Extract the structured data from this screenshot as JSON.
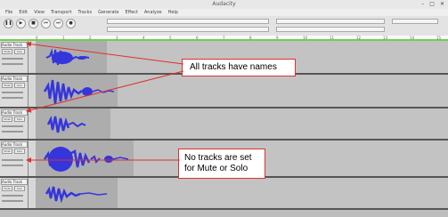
{
  "app": {
    "title": "Audacity"
  },
  "window_controls": {
    "minimize": "–",
    "maximize": "□",
    "close": "✕"
  },
  "menu": [
    "File",
    "Edit",
    "View",
    "Transport",
    "Tracks",
    "Generate",
    "Effect",
    "Analyze",
    "Help"
  ],
  "toolbar": {
    "transport_icons": [
      "pause-icon",
      "play-icon",
      "stop-icon",
      "skip-start-icon",
      "skip-end-icon",
      "record-icon"
    ],
    "transport_glyphs": [
      "❚❚",
      "▶",
      "■",
      "⏮",
      "⏭",
      "●"
    ]
  },
  "ruler": {
    "ticks": [
      "0",
      "1",
      "2",
      "3",
      "4",
      "5",
      "6",
      "7",
      "8",
      "9",
      "10",
      "11",
      "12",
      "13",
      "14",
      "15"
    ]
  },
  "tracks": [
    {
      "name": "Audio Track",
      "mute_label": "Mute",
      "solo_label": "Solo"
    },
    {
      "name": "Audio Track",
      "mute_label": "Mute",
      "solo_label": "Solo"
    },
    {
      "name": "Audio Track",
      "mute_label": "Mute",
      "solo_label": "Solo"
    },
    {
      "name": "Audio Track",
      "mute_label": "Mute",
      "solo_label": "Solo"
    },
    {
      "name": "Audio Track",
      "mute_label": "Mute",
      "solo_label": "Solo"
    }
  ],
  "annotations": {
    "names": "All tracks have names",
    "mute_solo": "No tracks are set for Mute or Solo"
  },
  "colors": {
    "waveform": "#3535dc",
    "annotation": "#e03030",
    "selection": "#6fcf4f"
  }
}
